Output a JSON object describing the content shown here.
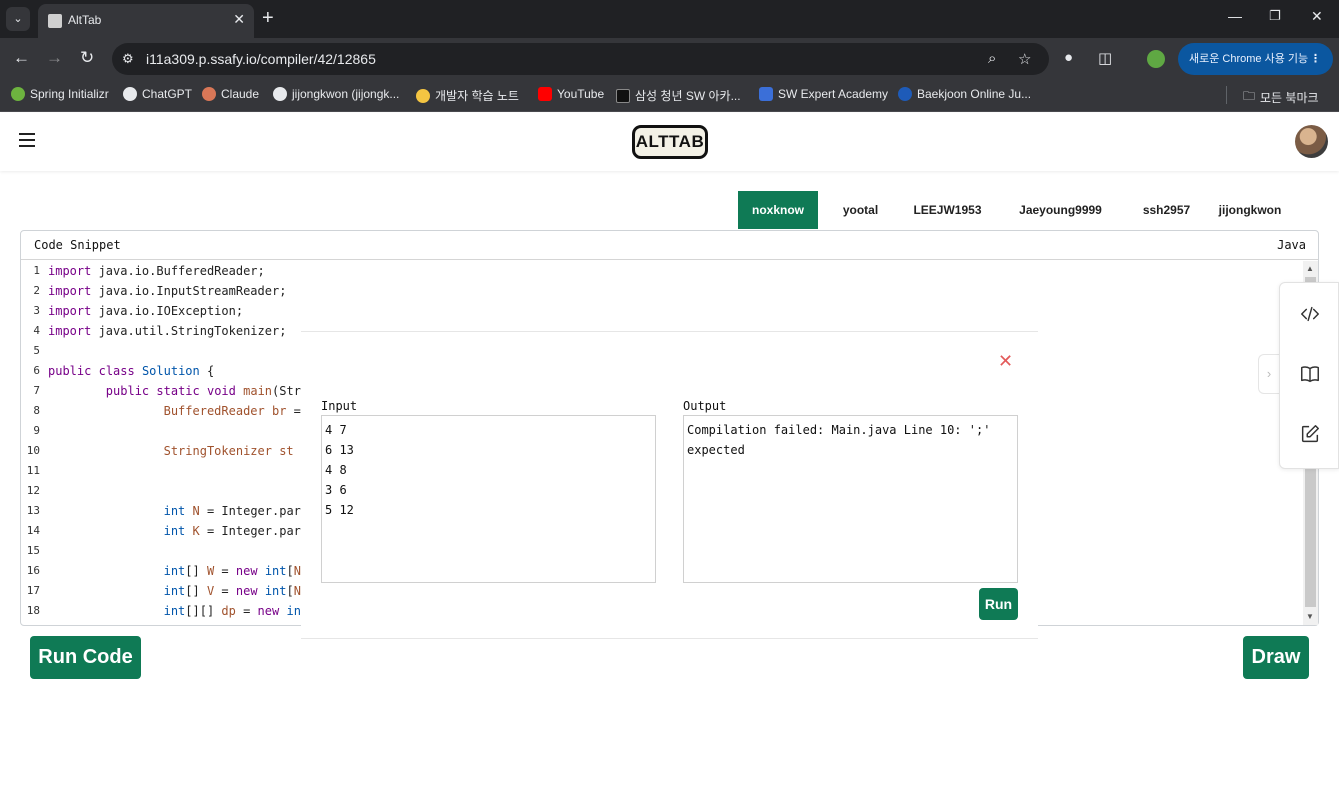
{
  "browser": {
    "tab_title": "AltTab",
    "url": "i11a309.p.ssafy.io/compiler/42/12865",
    "chrome_feature_label": "새로운 Chrome 사용 기능",
    "bookmarks": [
      {
        "label": "Spring Initializr",
        "color": "#6db33f"
      },
      {
        "label": "ChatGPT",
        "color": "#e8eaed"
      },
      {
        "label": "Claude",
        "color": "#d97757"
      },
      {
        "label": "jijongkwon (jijongk...",
        "color": "#e8eaed"
      },
      {
        "label": "개발자 학습 노트",
        "color": "#f4c542"
      },
      {
        "label": "YouTube",
        "color": "#ff0000"
      },
      {
        "label": "삼성 청년 SW 아카...",
        "color": "#111111"
      },
      {
        "label": "SW Expert Academy",
        "color": "#3b6fd8"
      },
      {
        "label": "Baekjoon Online Ju...",
        "color": "#1e5bb8"
      }
    ],
    "all_bookmarks": "모든 북마크"
  },
  "app": {
    "logo_text": "ALTTAB",
    "users": [
      "noxknow",
      "yootal",
      "LEEJW1953",
      "Jaeyoung9999",
      "ssh2957",
      "jijongkwon"
    ],
    "active_user_color": "#0f7a55"
  },
  "editor": {
    "title": "Code Snippet",
    "language": "Java",
    "lines": [
      {
        "n": "1",
        "code": "import java.io.BufferedReader;"
      },
      {
        "n": "2",
        "code": "import java.io.InputStreamReader;"
      },
      {
        "n": "3",
        "code": "import java.io.IOException;"
      },
      {
        "n": "4",
        "code": "import java.util.StringTokenizer;"
      },
      {
        "n": "5",
        "code": ""
      },
      {
        "n": "6",
        "code": "public class Solution {"
      },
      {
        "n": "7",
        "code": "        public static void main(Stri"
      },
      {
        "n": "8",
        "code": "                BufferedReader br = "
      },
      {
        "n": "9",
        "code": ""
      },
      {
        "n": "10",
        "code": "                StringTokenizer st = "
      },
      {
        "n": "11",
        "code": ""
      },
      {
        "n": "12",
        "code": ""
      },
      {
        "n": "13",
        "code": "                int N = Integer.pars"
      },
      {
        "n": "14",
        "code": "                int K = Integer.pars"
      },
      {
        "n": "15",
        "code": ""
      },
      {
        "n": "16",
        "code": "                int[] W = new int[N"
      },
      {
        "n": "17",
        "code": "                int[] V = new int[N"
      },
      {
        "n": "18",
        "code": "                int[][] dp = new int"
      }
    ]
  },
  "buttons": {
    "run_code": "Run Code",
    "draw": "Draw",
    "run": "Run"
  },
  "modal": {
    "input_label": "Input",
    "output_label": "Output",
    "input_value": "4 7\n6 13\n4 8\n3 6\n5 12",
    "output_value": "Compilation failed: Main.java Line 10: ';'\nexpected",
    "close_icon": "close-icon"
  },
  "colors": {
    "accent_green": "#0f7a55",
    "keyword_purple": "#770088",
    "type_blue": "#0055aa",
    "var_orange": "#a0522d",
    "close_red": "#e35a5a"
  }
}
